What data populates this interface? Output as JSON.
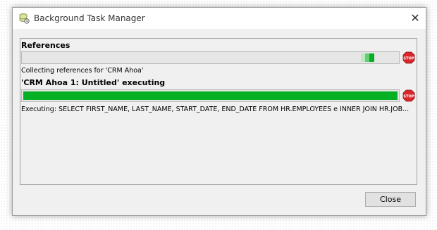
{
  "window": {
    "title": "Background Task Manager",
    "close_glyph": "✕"
  },
  "tasks": [
    {
      "title": "References",
      "status": "Collecting references for 'CRM Ahoa'",
      "progress": "indeterminate",
      "stop_label": "STOP"
    },
    {
      "title": "'CRM Ahoa 1: Untitled' executing",
      "status": "Executing: SELECT FIRST_NAME, LAST_NAME, START_DATE, END_DATE FROM HR.EMPLOYEES e INNER JOIN HR.JOB...",
      "progress": 1.0,
      "stop_label": "STOP"
    }
  ],
  "footer": {
    "close_label": "Close"
  },
  "colors": {
    "progress_green": "#06b025",
    "stop_red": "#d9262c"
  }
}
